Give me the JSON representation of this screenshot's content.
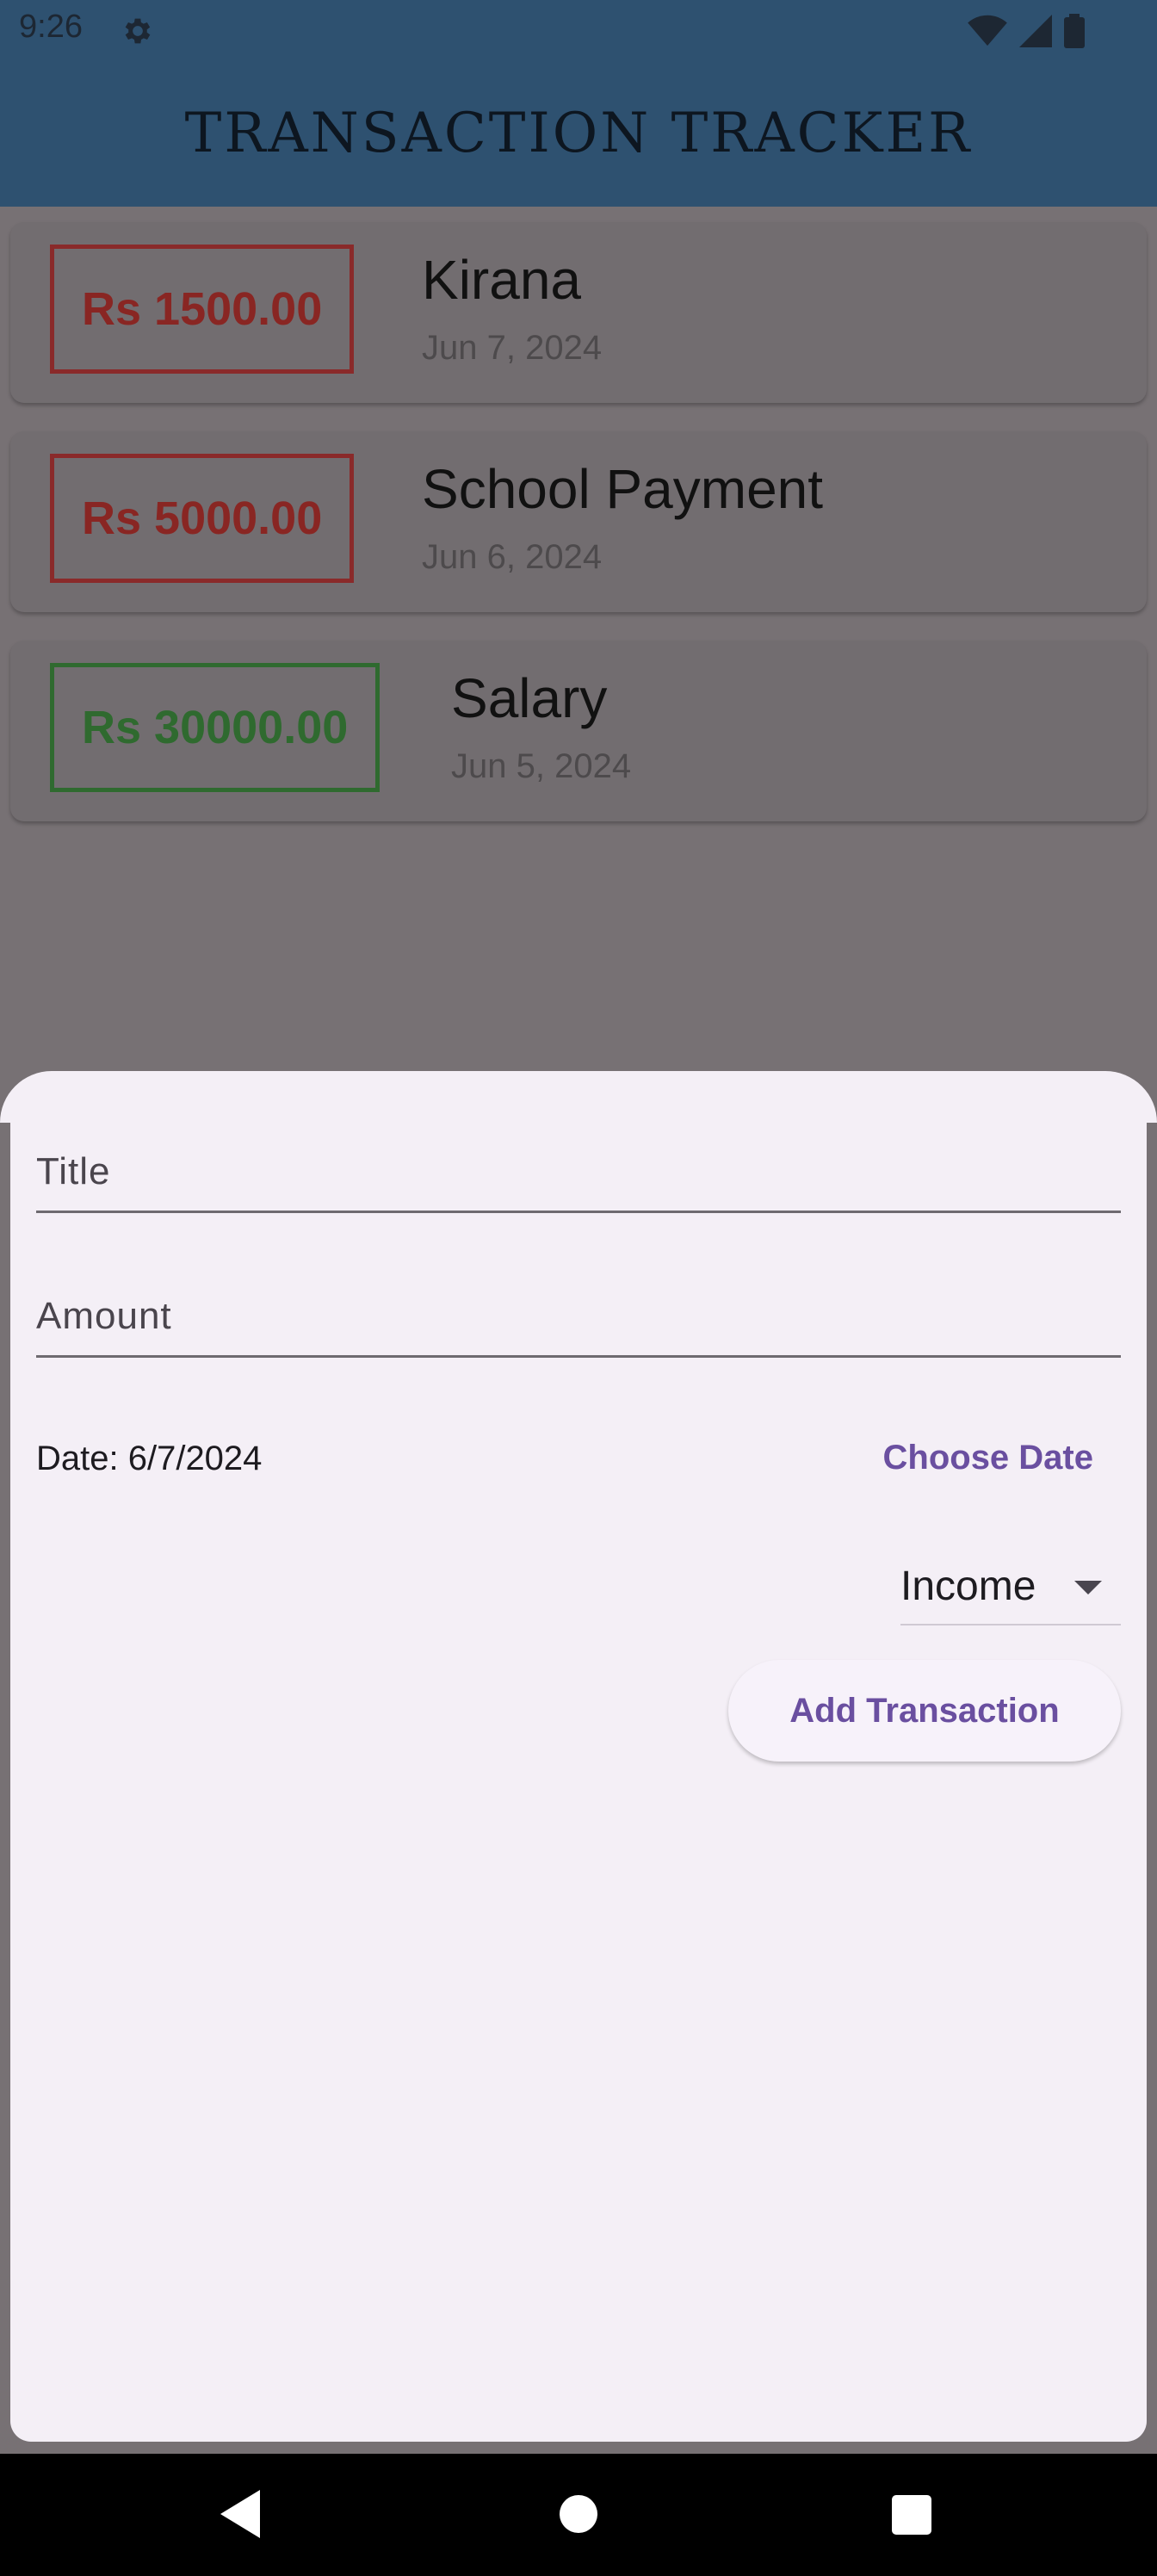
{
  "status_bar": {
    "time": "9:26",
    "icons": [
      "gear-icon",
      "wifi-icon",
      "signal-icon",
      "battery-icon"
    ]
  },
  "app_bar": {
    "title": "TRANSACTION TRACKER",
    "background": "#2e5170"
  },
  "transactions": [
    {
      "amount": "Rs 1500.00",
      "title": "Kirana",
      "date": "Jun 7, 2024",
      "kind": "expense"
    },
    {
      "amount": "Rs 5000.00",
      "title": "School Payment",
      "date": "Jun 6, 2024",
      "kind": "expense"
    },
    {
      "amount": "Rs 30000.00",
      "title": "Salary",
      "date": "Jun 5, 2024",
      "kind": "income"
    }
  ],
  "colors": {
    "expense": "#892623",
    "income": "#2f6a2f",
    "accent": "#6a4fa0",
    "sheet": "#f4eff6"
  },
  "form": {
    "title_placeholder": "Title",
    "title_value": "",
    "amount_placeholder": "Amount",
    "amount_value": "",
    "date_text": "Date: 6/7/2024",
    "choose_date_label": "Choose Date",
    "type_selected": "Income",
    "submit_label": "Add Transaction"
  },
  "nav_bar": {
    "buttons": [
      "back-icon",
      "home-icon",
      "recents-icon"
    ]
  }
}
